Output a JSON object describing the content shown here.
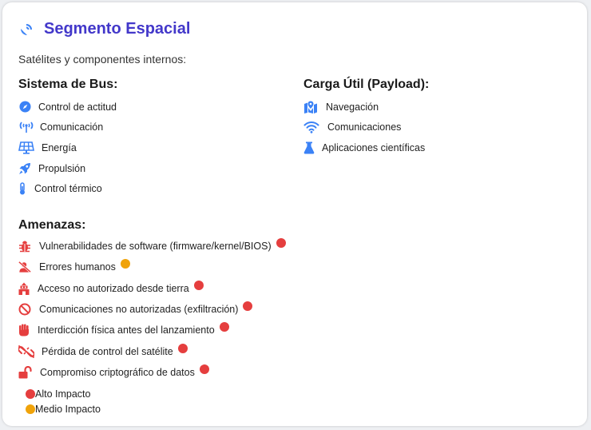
{
  "header": {
    "title": "Segmento Espacial",
    "subtitle": "Satélites y componentes internos:"
  },
  "bus": {
    "heading": "Sistema de Bus:",
    "items": [
      {
        "label": "Control de actitud",
        "icon": "compass-icon"
      },
      {
        "label": "Comunicación",
        "icon": "antenna-icon"
      },
      {
        "label": "Energía",
        "icon": "solar-panel-icon"
      },
      {
        "label": "Propulsión",
        "icon": "rocket-icon"
      },
      {
        "label": "Control térmico",
        "icon": "thermometer-icon"
      }
    ]
  },
  "payload": {
    "heading": "Carga Útil (Payload):",
    "items": [
      {
        "label": "Navegación",
        "icon": "map-location-icon"
      },
      {
        "label": "Comunicaciones",
        "icon": "wifi-icon"
      },
      {
        "label": "Aplicaciones científicas",
        "icon": "flask-icon"
      }
    ]
  },
  "threats": {
    "heading": "Amenazas:",
    "items": [
      {
        "label": "Vulnerabilidades de software (firmware/kernel/BIOS)",
        "icon": "bug-icon",
        "impact": "alto"
      },
      {
        "label": "Errores humanos",
        "icon": "user-slash-icon",
        "impact": "medio"
      },
      {
        "label": "Acceso no autorizado desde tierra",
        "icon": "ground-station-icon",
        "impact": "alto"
      },
      {
        "label": "Comunicaciones no autorizadas (exfiltración)",
        "icon": "ban-icon",
        "impact": "alto"
      },
      {
        "label": "Interdicción física antes del lanzamiento",
        "icon": "fist-icon",
        "impact": "alto"
      },
      {
        "label": "Pérdida de control del satélite",
        "icon": "broken-link-icon",
        "impact": "alto"
      },
      {
        "label": "Compromiso criptográfico de datos",
        "icon": "unlock-icon",
        "impact": "alto"
      }
    ]
  },
  "legend": {
    "high_label": "Alto Impacto",
    "medium_label": "Medio Impacto"
  },
  "colors": {
    "title": "#4338ca",
    "icon_blue": "#3b82f6",
    "threat_icon": "#e53e3e",
    "high_impact": "#e53e3e",
    "medium_impact": "#f0a30a"
  }
}
